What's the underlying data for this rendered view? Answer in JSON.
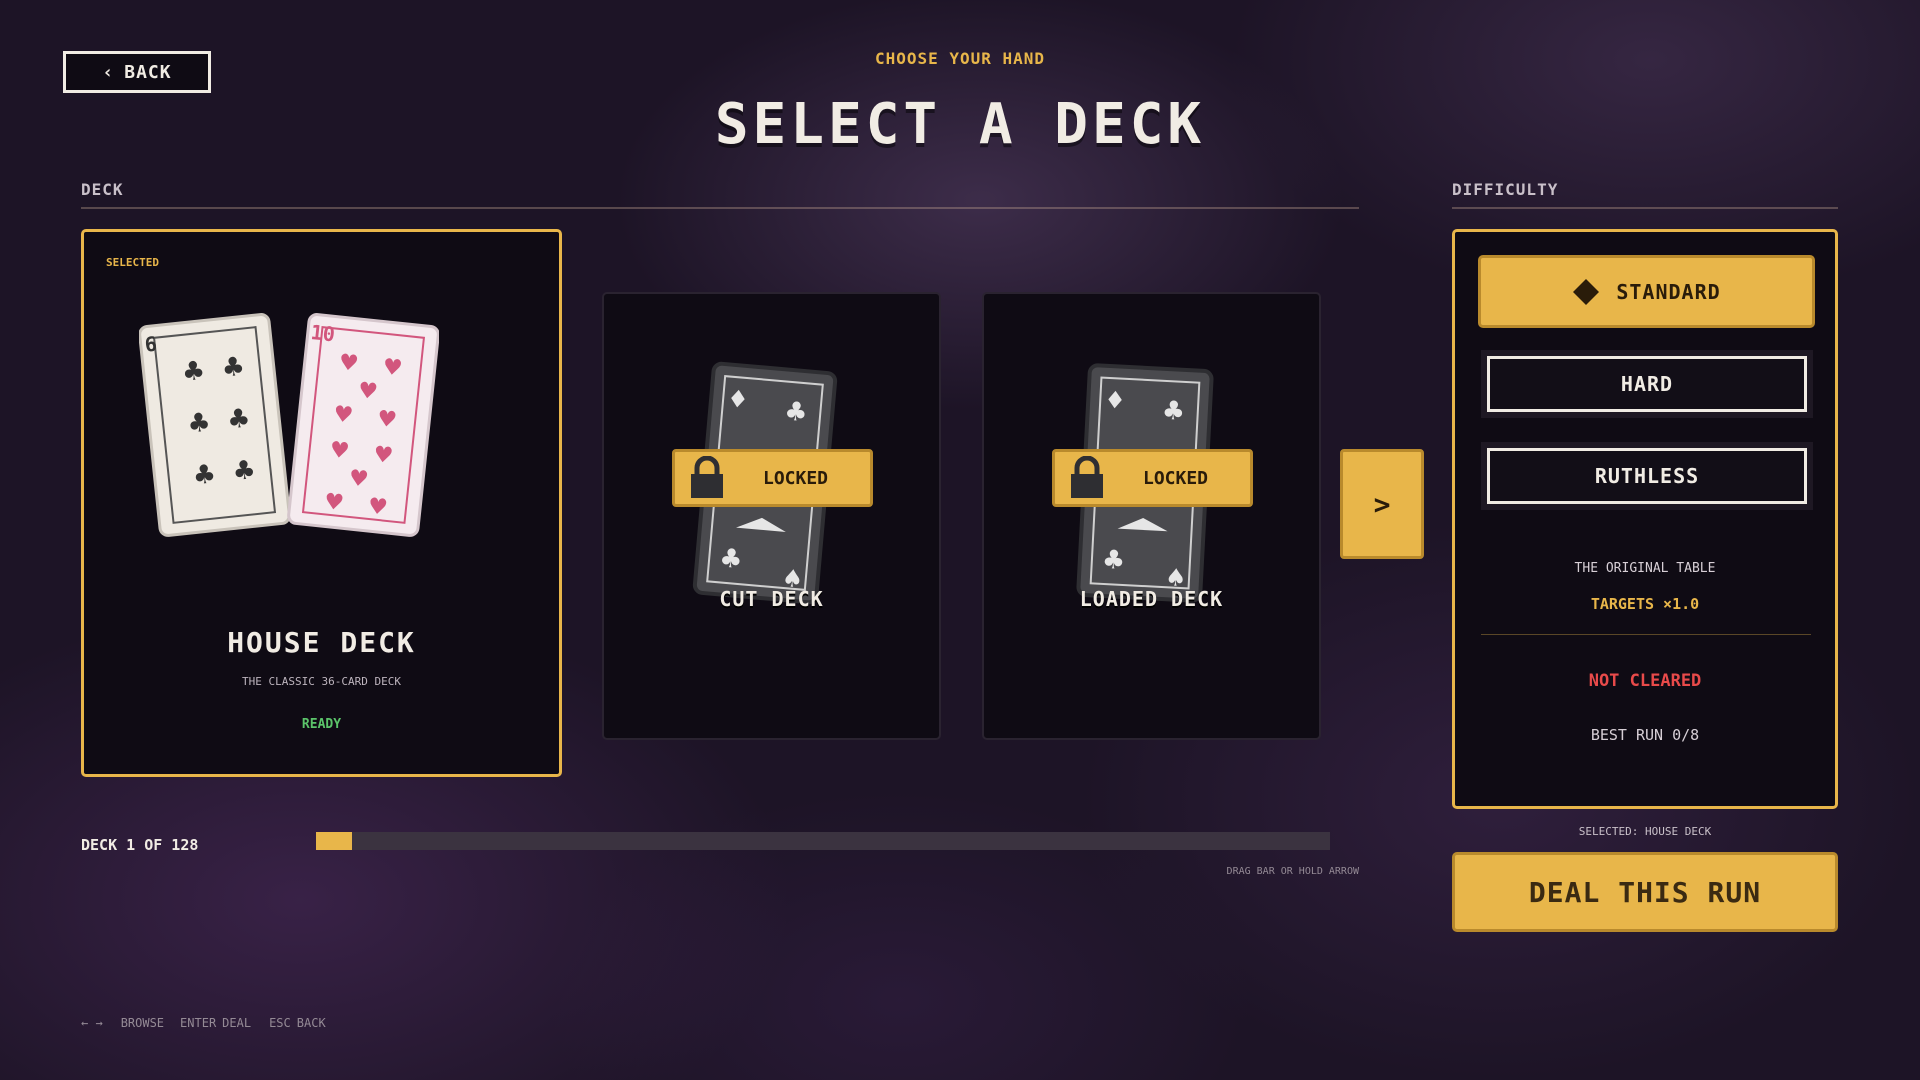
{
  "header": {
    "back_label": "Back",
    "subtitle": "Choose your hand",
    "title": "Select a Deck"
  },
  "deck_section": {
    "label": "Deck",
    "selected_card": {
      "badge": "Selected",
      "name": "House Deck",
      "description": "The classic 36-card deck",
      "status": "Ready",
      "card_left_rank": "6",
      "card_right_rank": "10"
    },
    "locked_cards": [
      {
        "name": "Cut Deck",
        "lock_label": "Locked"
      },
      {
        "name": "Loaded Deck",
        "lock_label": "Locked"
      }
    ],
    "next_arrow": ">",
    "progress": {
      "label": "Deck 1 of 128",
      "fraction": 0.0078,
      "hint": "Drag bar or hold arrow"
    }
  },
  "difficulty": {
    "label": "Difficulty",
    "options": [
      {
        "label": "Standard",
        "active": true
      },
      {
        "label": "Hard",
        "active": false
      },
      {
        "label": "Ruthless",
        "active": false
      }
    ],
    "description": "The original table",
    "targets": "Targets ×1.0",
    "status": "Not cleared",
    "best_run": "Best run  0/8"
  },
  "footer": {
    "selected_note": "Selected: House Deck",
    "deal_label": "Deal this run",
    "controls": {
      "arrows": "← →",
      "browse": "Browse",
      "enter": "Enter",
      "deal": "Deal",
      "esc": "Esc",
      "back": "Back"
    }
  },
  "colors": {
    "accent": "#e8b64a",
    "background": "#1d1426",
    "panel": "#0f0b14",
    "ready": "#5bc46a",
    "danger": "#e84a4a"
  }
}
